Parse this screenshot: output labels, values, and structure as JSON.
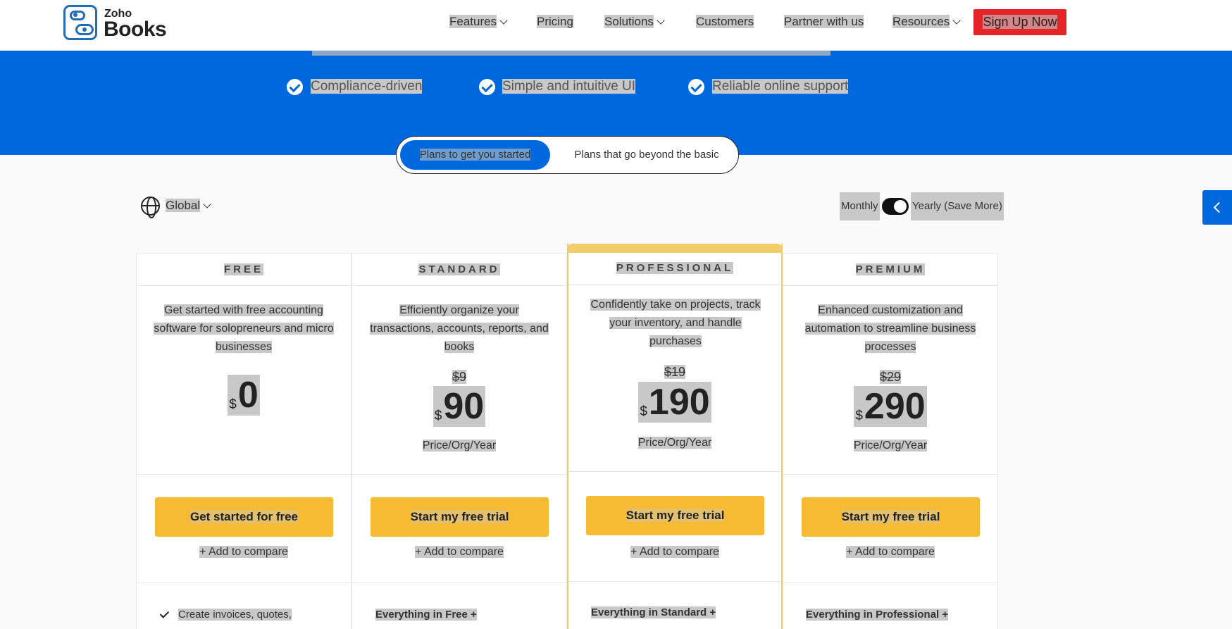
{
  "brand": {
    "company": "Zoho",
    "product": "Books"
  },
  "nav": {
    "features": "Features",
    "pricing": "Pricing",
    "solutions": "Solutions",
    "customers": "Customers",
    "partner": "Partner with us",
    "resources": "Resources",
    "signup": "Sign Up Now"
  },
  "hero": {
    "features": [
      "Compliance-driven",
      "Simple and intuitive UI",
      "Reliable online support"
    ]
  },
  "plan_tabs": {
    "active": "Plans to get you started",
    "other": "Plans that go beyond the basic"
  },
  "region": {
    "selected": "Global"
  },
  "billing": {
    "monthly": "Monthly",
    "yearly": "Yearly (Save More)",
    "yearly_selected": true
  },
  "colors": {
    "brand_blue": "#0068de",
    "cta_yellow": "#f6bb33",
    "signup_red": "#e42527",
    "highlight_band": "#f2cd6b"
  },
  "plans": [
    {
      "name": "FREE",
      "description": "Get started with free accounting software for solopreneurs and micro businesses",
      "old_price": "",
      "currency": "$",
      "price": "0",
      "period": "",
      "cta": "Get started for free",
      "compare": "+ Add to compare",
      "feature_header": "",
      "first_feature": "Create invoices, quotes,"
    },
    {
      "name": "STANDARD",
      "description": "Efficiently organize your transactions, accounts, reports, and books",
      "old_price": "$9",
      "currency": "$",
      "price": "90",
      "period": "Price/Org/Year",
      "cta": "Start my free trial",
      "compare": "+ Add to compare",
      "feature_header": "Everything in Free +"
    },
    {
      "name": "PROFESSIONAL",
      "description": "Confidently take on projects, track your inventory, and handle purchases",
      "old_price": "$19",
      "currency": "$",
      "price": "190",
      "period": "Price/Org/Year",
      "cta": "Start my free trial",
      "compare": "+ Add to compare",
      "feature_header": "Everything in Standard +"
    },
    {
      "name": "PREMIUM",
      "description": "Enhanced customization and automation to streamline business processes",
      "old_price": "$29",
      "currency": "$",
      "price": "290",
      "period": "Price/Org/Year",
      "cta": "Start my free trial",
      "compare": "+ Add to compare",
      "feature_header": "Everything in Professional +"
    }
  ]
}
